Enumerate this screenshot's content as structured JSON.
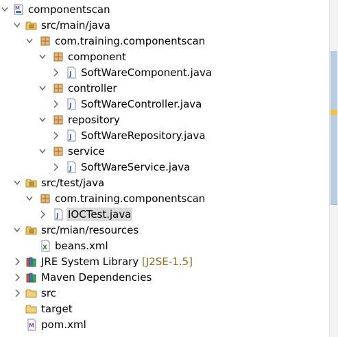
{
  "tree": [
    {
      "label": "componentscan",
      "icon": "maven-project-icon",
      "expander": "expanded"
    },
    {
      "label": "src/main/java",
      "icon": "source-folder-icon",
      "expander": "expanded"
    },
    {
      "label": "com.training.componentscan",
      "icon": "package-icon",
      "expander": "expanded"
    },
    {
      "label": "component",
      "icon": "package-icon",
      "expander": "expanded"
    },
    {
      "label": "SoftWareComponent.java",
      "icon": "java-file-icon",
      "expander": "collapsed"
    },
    {
      "label": "controller",
      "icon": "package-icon",
      "expander": "expanded"
    },
    {
      "label": "SoftWareController.java",
      "icon": "java-file-icon",
      "expander": "collapsed"
    },
    {
      "label": "repository",
      "icon": "package-icon",
      "expander": "expanded"
    },
    {
      "label": "SoftWareRepository.java",
      "icon": "java-file-icon",
      "expander": "collapsed"
    },
    {
      "label": "service",
      "icon": "package-icon",
      "expander": "expanded"
    },
    {
      "label": "SoftWareService.java",
      "icon": "java-file-icon",
      "expander": "collapsed"
    },
    {
      "label": "src/test/java",
      "icon": "source-folder-icon",
      "expander": "expanded"
    },
    {
      "label": "com.training.componentscan",
      "icon": "package-icon",
      "expander": "expanded"
    },
    {
      "label": "IOCTest.java",
      "icon": "java-file-icon",
      "expander": "collapsed",
      "selected": true
    },
    {
      "label": "src/mian/resources",
      "icon": "source-folder-icon",
      "expander": "expanded"
    },
    {
      "label": "beans.xml",
      "icon": "xml-file-icon",
      "expander": "none"
    },
    {
      "label": "JRE System Library",
      "decoration": "[J2SE-1.5]",
      "icon": "library-icon",
      "expander": "collapsed"
    },
    {
      "label": "Maven Dependencies",
      "icon": "library-icon",
      "expander": "collapsed"
    },
    {
      "label": "src",
      "icon": "folder-icon",
      "expander": "collapsed"
    },
    {
      "label": "target",
      "icon": "folder-icon",
      "expander": "none"
    },
    {
      "label": "pom.xml",
      "icon": "maven-file-icon",
      "expander": "none"
    }
  ]
}
